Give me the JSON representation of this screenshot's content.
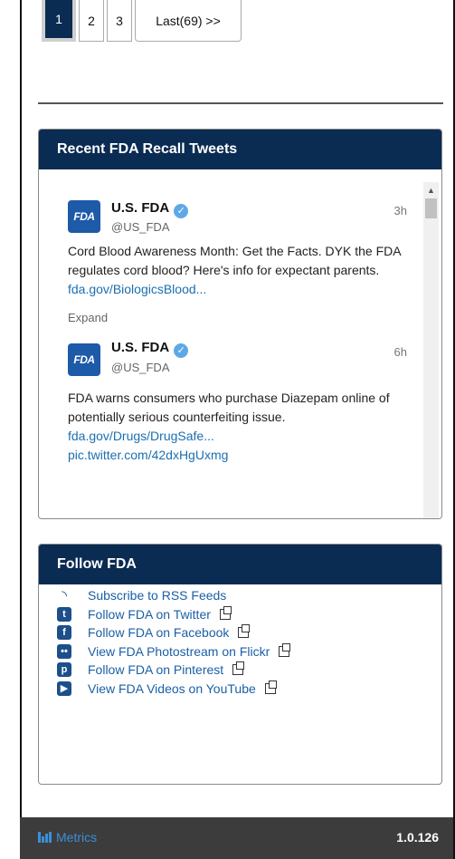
{
  "pagination": {
    "pages": [
      "1",
      "2",
      "3"
    ],
    "last_label": "Last(69) >>",
    "active_page": "1"
  },
  "recall_tweets": {
    "title": "Recent FDA Recall Tweets",
    "tweets": [
      {
        "logo": "FDA",
        "name": "U.S. FDA",
        "handle": "@US_FDA",
        "time": "3h",
        "text": "Cord Blood Awareness Month: Get the Facts. DYK the FDA regulates cord blood? Here's info for expectant parents.",
        "link": "fda.gov/BiologicsBlood...",
        "expand": "Expand"
      },
      {
        "logo": "FDA",
        "name": "U.S. FDA",
        "handle": "@US_FDA",
        "time": "6h",
        "text": "FDA warns consumers who purchase Diazepam online of potentially serious counterfeiting issue.",
        "link": "fda.gov/Drugs/DrugSafe...",
        "link2": "pic.twitter.com/42dxHgUxmg"
      }
    ]
  },
  "follow": {
    "title": "Follow FDA",
    "items": [
      {
        "label": "Subscribe to RSS Feeds",
        "icon": "rss-icon",
        "external": false
      },
      {
        "label": "Follow FDA on Twitter",
        "icon": "twitter-icon",
        "external": true
      },
      {
        "label": "Follow FDA on Facebook",
        "icon": "facebook-icon",
        "external": true
      },
      {
        "label": "View FDA Photostream on Flickr",
        "icon": "flickr-icon",
        "external": true
      },
      {
        "label": "Follow FDA on Pinterest",
        "icon": "pinterest-icon",
        "external": true
      },
      {
        "label": "View FDA Videos on YouTube",
        "icon": "youtube-icon",
        "external": true
      }
    ]
  },
  "footer": {
    "metrics_label": "Metrics",
    "version": "1.0.126"
  },
  "colors": {
    "header_bg": "#0a2b52",
    "link": "#1b5fa6",
    "footer_bg": "#3c3c3c"
  }
}
